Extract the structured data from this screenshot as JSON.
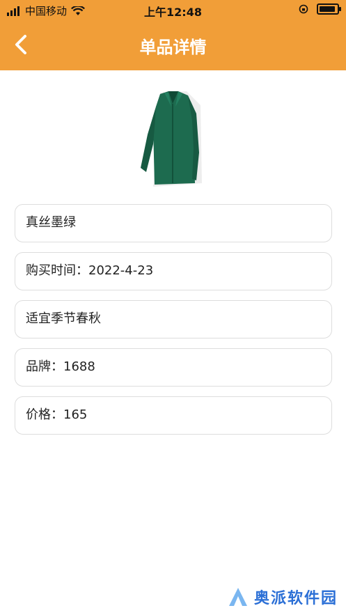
{
  "status_bar": {
    "carrier": "中国移动",
    "time": "上午12:48",
    "battery_level": 0.9
  },
  "nav": {
    "title": "单品详情",
    "back_icon": "chevron-left-icon"
  },
  "product": {
    "image_icon": "green-shirt-image"
  },
  "details": [
    {
      "text": "真丝墨绿"
    },
    {
      "text": "购买时间：2022-4-23"
    },
    {
      "text": "适宜季节春秋"
    },
    {
      "text": "品牌：1688"
    },
    {
      "text": "价格：165"
    }
  ],
  "watermark": {
    "text": "奥派软件园"
  },
  "colors": {
    "header": "#F19E38",
    "border": "#dddddd",
    "shirt": "#1d6b4f"
  }
}
